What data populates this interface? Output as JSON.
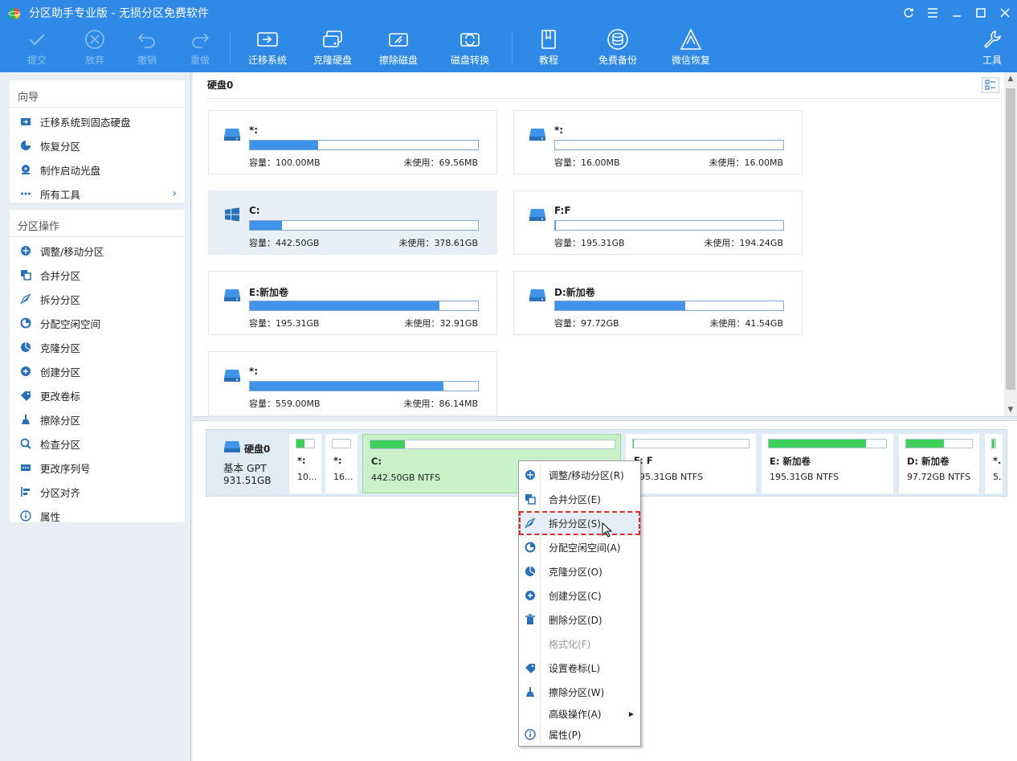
{
  "window": {
    "title": "分区助手专业版 - 无损分区免费软件"
  },
  "toolbar": {
    "items": [
      {
        "label": "提交",
        "icon": "check-icon",
        "disabled": true
      },
      {
        "label": "放弃",
        "icon": "cancel-icon",
        "disabled": true
      },
      {
        "label": "撤销",
        "icon": "undo-icon",
        "disabled": true
      },
      {
        "label": "重做",
        "icon": "redo-icon",
        "disabled": true
      },
      {
        "label": "迁移系统",
        "icon": "migrate-os-icon"
      },
      {
        "label": "克隆硬盘",
        "icon": "clone-disk-icon"
      },
      {
        "label": "擦除磁盘",
        "icon": "wipe-disk-icon"
      },
      {
        "label": "磁盘转换",
        "icon": "disk-convert-icon"
      },
      {
        "label": "教程",
        "icon": "tutorial-book-icon"
      },
      {
        "label": "免费备份",
        "icon": "free-backup-icon"
      },
      {
        "label": "微信恢复",
        "icon": "wechat-recovery-icon"
      },
      {
        "label": "工具",
        "icon": "tools-wrench-icon"
      }
    ]
  },
  "sidebar": {
    "wizard": {
      "title": "向导",
      "items": [
        {
          "label": "迁移系统到固态硬盘",
          "icon": "migrate-ssd-icon"
        },
        {
          "label": "恢复分区",
          "icon": "recover-partition-icon"
        },
        {
          "label": "制作启动光盘",
          "icon": "bootable-media-icon"
        },
        {
          "label": "所有工具",
          "icon": "all-tools-icon"
        }
      ]
    },
    "operations": {
      "title": "分区操作",
      "items": [
        {
          "label": "调整/移动分区",
          "icon": "resize-move-icon"
        },
        {
          "label": "合并分区",
          "icon": "merge-icon"
        },
        {
          "label": "拆分分区",
          "icon": "split-icon"
        },
        {
          "label": "分配空闲空间",
          "icon": "allocate-space-icon"
        },
        {
          "label": "克隆分区",
          "icon": "clone-partition-icon"
        },
        {
          "label": "创建分区",
          "icon": "create-partition-icon"
        },
        {
          "label": "更改卷标",
          "icon": "label-tag-icon"
        },
        {
          "label": "擦除分区",
          "icon": "wipe-partition-icon"
        },
        {
          "label": "检查分区",
          "icon": "check-partition-icon"
        },
        {
          "label": "更改序列号",
          "icon": "serial-number-icon"
        },
        {
          "label": "分区对齐",
          "icon": "align-icon"
        },
        {
          "label": "属性",
          "icon": "info-icon"
        }
      ]
    }
  },
  "disk_view": {
    "disk_title": "硬盘0",
    "cap_prefix": "容量：",
    "free_prefix": "未使用：",
    "partitions": [
      {
        "name": "*:",
        "capacity": "100.00MB",
        "free": "69.56MB",
        "used_fraction": 0.3,
        "icon": "disk-drive-icon"
      },
      {
        "name": "*:",
        "capacity": "16.00MB",
        "free": "16.00MB",
        "used_fraction": 0.0,
        "icon": "disk-drive-icon"
      },
      {
        "name": "C:",
        "capacity": "442.50GB",
        "free": "378.61GB",
        "used_fraction": 0.14,
        "icon": "windows-icon",
        "selected": true
      },
      {
        "name": "F:F",
        "capacity": "195.31GB",
        "free": "194.24GB",
        "used_fraction": 0.005,
        "icon": "disk-drive-icon"
      },
      {
        "name": "E:新加卷",
        "capacity": "195.31GB",
        "free": "32.91GB",
        "used_fraction": 0.83,
        "icon": "disk-drive-icon"
      },
      {
        "name": "D:新加卷",
        "capacity": "97.72GB",
        "free": "41.54GB",
        "used_fraction": 0.57,
        "icon": "disk-drive-icon"
      },
      {
        "name": "*:",
        "capacity": "559.00MB",
        "free": "86.14MB",
        "used_fraction": 0.85,
        "icon": "disk-drive-icon"
      }
    ]
  },
  "disk_map": {
    "disk_name": "硬盘0",
    "disk_type": "基本 GPT",
    "disk_size": "931.51GB",
    "segments": [
      {
        "l1": "*:",
        "l2": "10...",
        "used_fraction": 0.45
      },
      {
        "l1": "*:",
        "l2": "16...",
        "used_fraction": 0.0
      },
      {
        "l1": "C:",
        "l2": "442.50GB NTFS",
        "used_fraction": 0.14,
        "selected": true
      },
      {
        "l1": "F: F",
        "l2": "195.31GB NTFS",
        "used_fraction": 0.005
      },
      {
        "l1": "E: 新加卷",
        "l2": "195.31GB NTFS",
        "used_fraction": 0.83
      },
      {
        "l1": "D: 新加卷",
        "l2": "97.72GB NTFS",
        "used_fraction": 0.57
      },
      {
        "l1": "*.",
        "l2": "5...",
        "used_fraction": 0.85
      }
    ]
  },
  "context_menu": {
    "items": [
      {
        "label": "调整/移动分区(R)",
        "icon": "resize-move-icon"
      },
      {
        "label": "合并分区(E)",
        "icon": "merge-icon"
      },
      {
        "label": "拆分分区(S)",
        "icon": "split-icon",
        "highlighted": true
      },
      {
        "label": "分配空闲空间(A)",
        "icon": "allocate-space-icon"
      },
      {
        "label": "克隆分区(O)",
        "icon": "clone-partition-icon"
      },
      {
        "label": "创建分区(C)",
        "icon": "create-partition-icon"
      },
      {
        "label": "删除分区(D)",
        "icon": "delete-trash-icon"
      },
      {
        "label": "格式化(F)",
        "icon": "",
        "disabled": true
      },
      {
        "label": "设置卷标(L)",
        "icon": "label-tag-icon"
      },
      {
        "label": "擦除分区(W)",
        "icon": "wipe-partition-icon"
      },
      {
        "label": "高级操作(A)",
        "icon": "",
        "submenu": true
      },
      {
        "label": "属性(P)",
        "icon": "info-icon"
      }
    ]
  },
  "colors": {
    "accent": "#2e8ae6",
    "bar_fill": "#3f93eb",
    "map_fill": "#3ed05a",
    "highlight_border": "#e02a2a"
  }
}
